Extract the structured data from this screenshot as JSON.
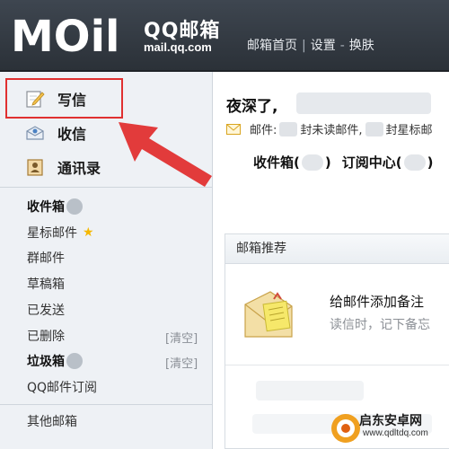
{
  "header": {
    "logo_text": "MOil",
    "brand_cn": "QQ邮箱",
    "brand_url": "mail.qq.com",
    "nav": [
      "邮箱首页",
      "设置",
      "换肤"
    ]
  },
  "sidebar": {
    "actions": [
      {
        "label": "写信",
        "icon": "compose-icon"
      },
      {
        "label": "收信",
        "icon": "inbox-receive-icon"
      },
      {
        "label": "通讯录",
        "icon": "contacts-icon"
      }
    ],
    "folders": [
      {
        "label": "收件箱",
        "bold": true
      },
      {
        "label": "星标邮件",
        "star": true
      },
      {
        "label": "群邮件"
      },
      {
        "label": "草稿箱"
      },
      {
        "label": "已发送"
      },
      {
        "label": "已删除",
        "action": "[清空]"
      },
      {
        "label": "垃圾箱",
        "bold": true,
        "action": "[清空]"
      },
      {
        "label": "QQ邮件订阅"
      }
    ],
    "other": "其他邮箱"
  },
  "main": {
    "greeting": "夜深了,",
    "mail_prefix": "邮件:",
    "unread_text": "封未读邮件,",
    "star_text": "封星标邮",
    "inbox_label": "收件箱(",
    "inbox_close": ")",
    "subscribe_label": "订阅中心(",
    "subscribe_close": ")"
  },
  "recommend": {
    "header": "邮箱推荐",
    "title": "给邮件添加备注",
    "subtitle": "读信时，记下备忘"
  },
  "watermark": {
    "name": "启东安卓网",
    "url": "www.qdltdq.com"
  },
  "colors": {
    "header_bg": "#333a42",
    "sidebar_bg": "#eef1f5",
    "annotation_red": "#e03030",
    "star": "#f5b800"
  }
}
